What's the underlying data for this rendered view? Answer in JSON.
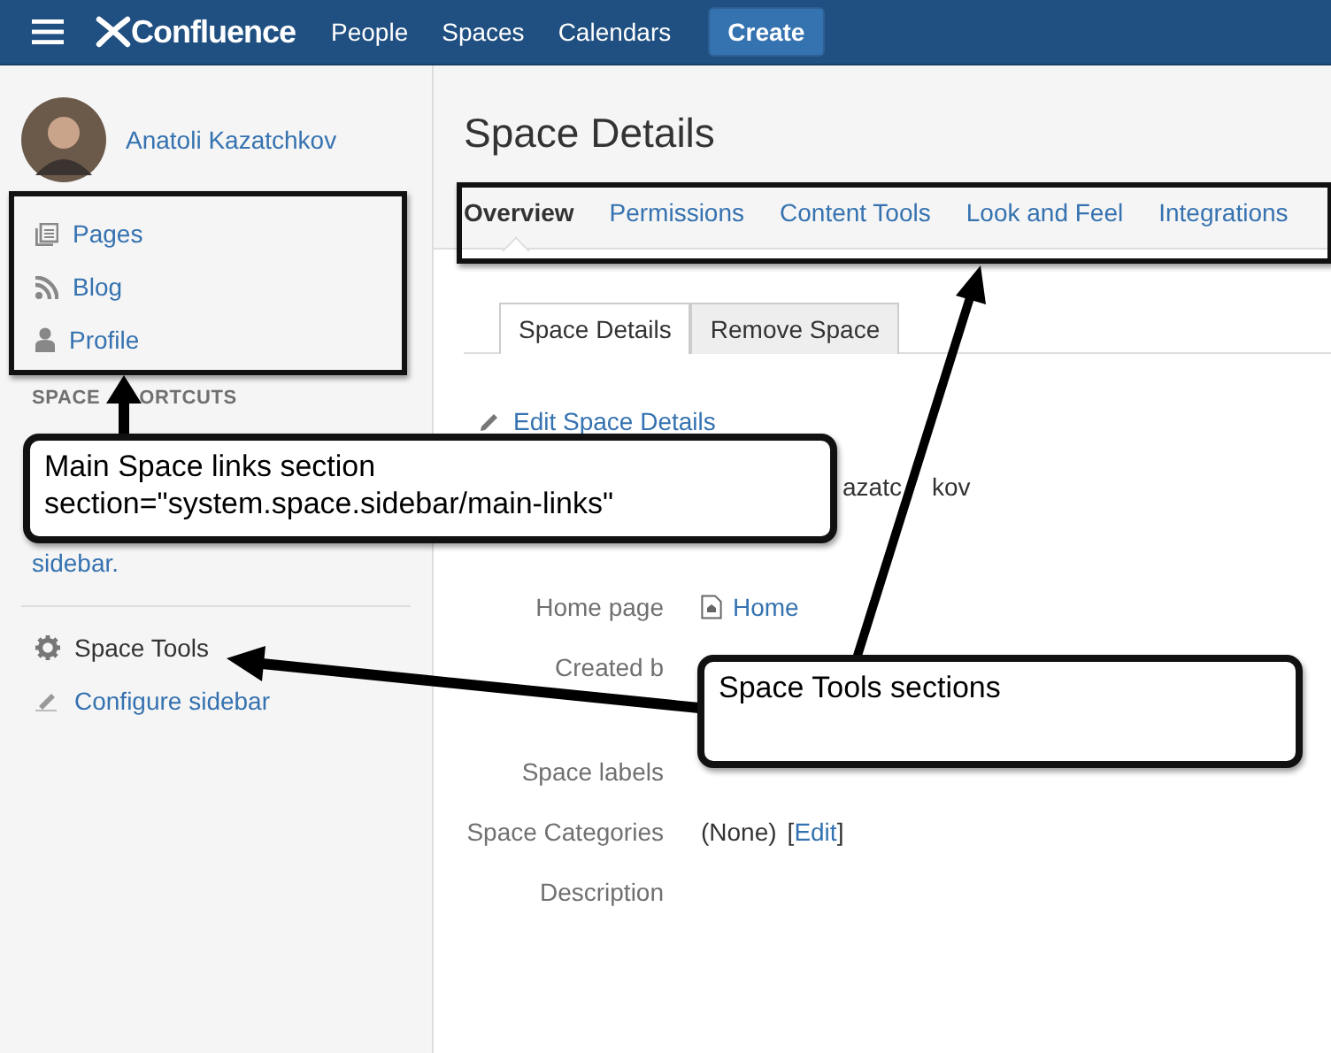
{
  "topbar": {
    "logo": "Confluence",
    "nav": [
      "People",
      "Spaces",
      "Calendars"
    ],
    "create": "Create"
  },
  "sidebar": {
    "user": "Anatoli Kazatchkov",
    "main_links": [
      {
        "label": "Pages",
        "kind": "pages"
      },
      {
        "label": "Blog",
        "kind": "blog"
      },
      {
        "label": "Profile",
        "kind": "profile"
      }
    ],
    "shortcuts_heading": [
      "SPACE",
      "ORTCUTS"
    ],
    "shortcuts_text": "sidebar.",
    "tools": [
      {
        "label": "Space Tools",
        "kind": "tools"
      },
      {
        "label": "Configure sidebar",
        "kind": "configure"
      }
    ]
  },
  "page": {
    "title": "Space Details",
    "tabs": [
      {
        "label": "Overview",
        "selected": true
      },
      {
        "label": "Permissions",
        "selected": false
      },
      {
        "label": "Content Tools",
        "selected": false
      },
      {
        "label": "Look and Feel",
        "selected": false
      },
      {
        "label": "Integrations",
        "selected": false
      }
    ],
    "subtabs": [
      {
        "label": "Space Details",
        "selected": true
      },
      {
        "label": "Remove Space",
        "selected": false
      }
    ],
    "edit_link": "Edit Space Details",
    "details": [
      {
        "value_parts": [
          "azatc",
          "kov"
        ],
        "kind": "fragment"
      },
      {
        "label": "Home page",
        "value": "Home",
        "kind": "page"
      },
      {
        "label": "Created b",
        "kind": "text"
      },
      {
        "label": "Space labels",
        "kind": "text"
      },
      {
        "label": "Space Categories",
        "value": "(None)",
        "edit": "Edit",
        "brackets": [
          "[",
          "]"
        ],
        "kind": "edit"
      },
      {
        "label": "Description",
        "kind": "text"
      }
    ]
  },
  "annotations": [
    {
      "lines": [
        "Main Space links section",
        "section=\"system.space.sidebar/main-links\""
      ]
    },
    {
      "lines": [
        "Space Tools sections"
      ]
    }
  ]
}
